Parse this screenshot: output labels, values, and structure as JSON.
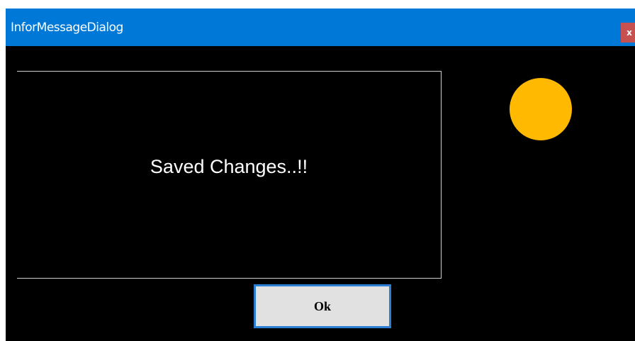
{
  "window": {
    "title": "InforMessageDialog",
    "close_label": "x"
  },
  "message": {
    "text": "Saved Changes..!!"
  },
  "status_indicator": {
    "color": "#ffb900"
  },
  "buttons": {
    "ok_label": "Ok"
  },
  "colors": {
    "titlebar": "#0078d7",
    "background": "#000000",
    "close": "#c75050",
    "button_border": "#2a7fd4"
  }
}
